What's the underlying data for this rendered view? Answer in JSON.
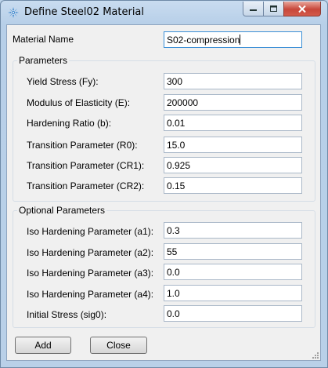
{
  "window": {
    "title": "Define Steel02 Material",
    "controls": {
      "minimize_icon": "minimize-icon",
      "maximize_icon": "maximize-icon",
      "close_icon": "close-icon"
    }
  },
  "material": {
    "label": "Material Name",
    "value": "S02-compression"
  },
  "parameters": {
    "title": "Parameters",
    "fields": [
      {
        "label": "Yield Stress (Fy):",
        "value": "300"
      },
      {
        "label": "Modulus of Elasticity (E):",
        "value": "200000"
      },
      {
        "label": "Hardening Ratio (b):",
        "value": "0.01"
      },
      {
        "label": "Transition Parameter (R0):",
        "value": "15.0"
      },
      {
        "label": "Transition Parameter (CR1):",
        "value": "0.925"
      },
      {
        "label": "Transition Parameter (CR2):",
        "value": "0.15"
      }
    ]
  },
  "optional": {
    "title": "Optional Parameters",
    "fields": [
      {
        "label": "Iso Hardening Parameter (a1):",
        "value": "0.3"
      },
      {
        "label": "Iso Hardening Parameter (a2):",
        "value": "55"
      },
      {
        "label": "Iso Hardening Parameter (a3):",
        "value": "0.0"
      },
      {
        "label": "Iso Hardening Parameter (a4):",
        "value": "1.0"
      },
      {
        "label": "Initial Stress (sig0):",
        "value": "0.0"
      }
    ]
  },
  "buttons": {
    "add": "Add",
    "close": "Close"
  }
}
